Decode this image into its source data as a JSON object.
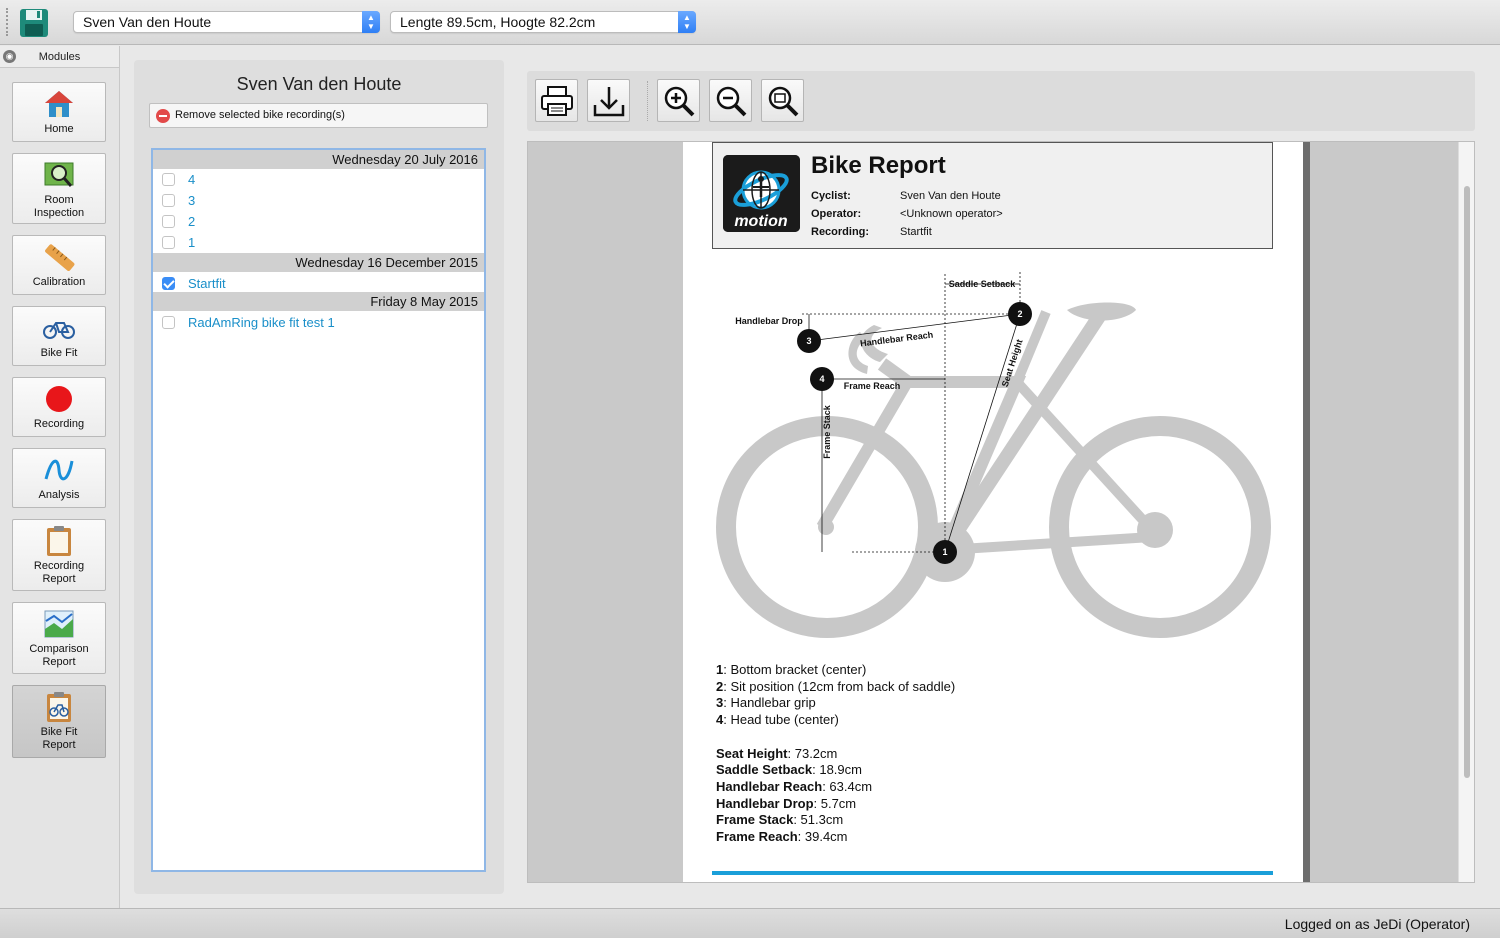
{
  "topbar": {
    "cyclist_select": "Sven Van den Houte",
    "fit_select": "Lengte 89.5cm, Hoogte 82.2cm",
    "save_icon": "floppy-disk-icon"
  },
  "modules": {
    "header": "Modules",
    "items": [
      {
        "label1": "Home",
        "label2": "",
        "icon": "home-icon"
      },
      {
        "label1": "Room",
        "label2": "Inspection",
        "icon": "room-inspection-icon"
      },
      {
        "label1": "Calibration",
        "label2": "",
        "icon": "ruler-icon"
      },
      {
        "label1": "Bike Fit",
        "label2": "",
        "icon": "bicycle-icon"
      },
      {
        "label1": "Recording",
        "label2": "",
        "icon": "record-icon"
      },
      {
        "label1": "Analysis",
        "label2": "",
        "icon": "analysis-icon"
      },
      {
        "label1": "Recording",
        "label2": "Report",
        "icon": "clipboard-icon"
      },
      {
        "label1": "Comparison",
        "label2": "Report",
        "icon": "comparison-chart-icon"
      },
      {
        "label1": "Bike Fit",
        "label2": "Report",
        "icon": "bike-fit-report-icon"
      }
    ],
    "active": "Bike Fit Report"
  },
  "recordings": {
    "title": "Sven Van den Houte",
    "remove_label": "Remove selected bike recording(s)",
    "groups": [
      {
        "date": "Wednesday 20 July 2016",
        "items": [
          {
            "name": "4",
            "checked": false
          },
          {
            "name": "3",
            "checked": false
          },
          {
            "name": "2",
            "checked": false
          },
          {
            "name": "1",
            "checked": false
          }
        ]
      },
      {
        "date": "Wednesday 16 December 2015",
        "items": [
          {
            "name": "Startfit",
            "checked": true
          }
        ]
      },
      {
        "date": "Friday 8 May 2015",
        "items": [
          {
            "name": "RadAmRing bike fit test 1",
            "checked": false
          }
        ]
      }
    ]
  },
  "toolbar": {
    "buttons": [
      "printer-icon",
      "download-icon",
      "zoom-in-icon",
      "zoom-out-icon",
      "zoom-fit-icon"
    ]
  },
  "report": {
    "title": "Bike Report",
    "logo_text": "motion",
    "cyclist_label": "Cyclist:",
    "cyclist_value": "Sven Van den Houte",
    "operator_label": "Operator:",
    "operator_value": "<Unknown operator>",
    "recording_label": "Recording:",
    "recording_value": "Startfit",
    "diagram": {
      "saddle_setback": "Saddle Setback",
      "handlebar_drop": "Handlebar Drop",
      "handlebar_reach": "Handlebar Reach",
      "seat_height": "Seat Height",
      "frame_reach": "Frame Reach",
      "frame_stack": "Frame Stack",
      "p1": "1",
      "p2": "2",
      "p3": "3",
      "p4": "4"
    },
    "points": [
      {
        "num": "1",
        "text": ": Bottom bracket (center)"
      },
      {
        "num": "2",
        "text": ": Sit position (12cm from back of saddle)"
      },
      {
        "num": "3",
        "text": ": Handlebar grip"
      },
      {
        "num": "4",
        "text": ": Head tube (center)"
      }
    ],
    "measurements": [
      {
        "name": "Seat Height",
        "value": ": 73.2cm"
      },
      {
        "name": "Saddle Setback",
        "value": ": 18.9cm"
      },
      {
        "name": "Handlebar Reach",
        "value": ": 63.4cm"
      },
      {
        "name": "Handlebar Drop",
        "value": ": 5.7cm"
      },
      {
        "name": "Frame Stack",
        "value": ": 51.3cm"
      },
      {
        "name": "Frame Reach",
        "value": ": 39.4cm"
      }
    ]
  },
  "status": {
    "text": "Logged on as JeDi (Operator)"
  },
  "colors": {
    "accent": "#1a8fc9",
    "report_line": "#1a9fd9",
    "stepper": "#3a8df6"
  }
}
